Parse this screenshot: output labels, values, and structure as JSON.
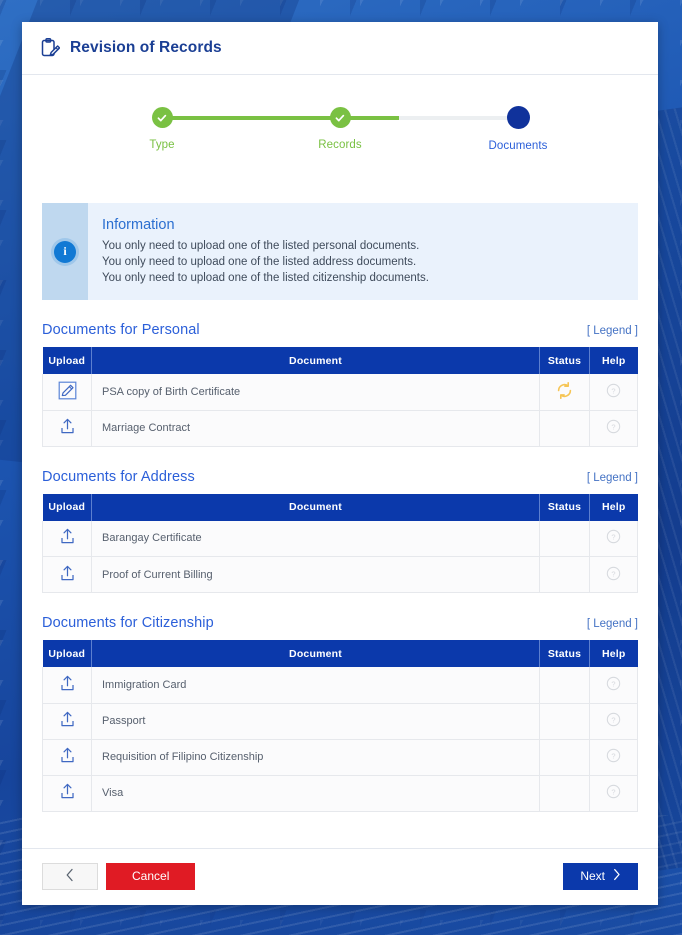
{
  "header": {
    "title": "Revision of Records",
    "icon": "clipboard-edit-icon"
  },
  "stepper": {
    "steps": [
      {
        "label": "Type",
        "state": "done",
        "icon": "check-icon"
      },
      {
        "label": "Records",
        "state": "done",
        "icon": "check-icon"
      },
      {
        "label": "Documents",
        "state": "active",
        "icon": "dot-icon"
      }
    ],
    "colors": {
      "done": "#7ac143",
      "active": "#10329b",
      "track": "#eceff1"
    }
  },
  "information": {
    "icon": "info-circle-icon",
    "title": "Information",
    "lines": [
      "You only need to upload one of the listed personal documents.",
      "You only need to upload one of the listed address documents.",
      "You only need to upload one of the listed citizenship documents."
    ]
  },
  "columns": {
    "upload": "Upload",
    "document": "Document",
    "status": "Status",
    "help": "Help"
  },
  "legend_label": "[ Legend ]",
  "sections": [
    {
      "title": "Documents for Personal",
      "rows": [
        {
          "document": "PSA copy of Birth Certificate",
          "upload_icon": "edit-pencil-icon",
          "status_icon": "sync-pending-icon",
          "help_icon": "help-circle-icon"
        },
        {
          "document": "Marriage Contract",
          "upload_icon": "upload-icon",
          "status_icon": "",
          "help_icon": "help-circle-icon"
        }
      ]
    },
    {
      "title": "Documents for Address",
      "rows": [
        {
          "document": "Barangay Certificate",
          "upload_icon": "upload-icon",
          "status_icon": "",
          "help_icon": "help-circle-icon"
        },
        {
          "document": "Proof of Current Billing",
          "upload_icon": "upload-icon",
          "status_icon": "",
          "help_icon": "help-circle-icon"
        }
      ]
    },
    {
      "title": "Documents for Citizenship",
      "rows": [
        {
          "document": "Immigration Card",
          "upload_icon": "upload-icon",
          "status_icon": "",
          "help_icon": "help-circle-icon"
        },
        {
          "document": "Passport",
          "upload_icon": "upload-icon",
          "status_icon": "",
          "help_icon": "help-circle-icon"
        },
        {
          "document": "Requisition of Filipino Citizenship",
          "upload_icon": "upload-icon",
          "status_icon": "",
          "help_icon": "help-circle-icon"
        },
        {
          "document": "Visa",
          "upload_icon": "upload-icon",
          "status_icon": "",
          "help_icon": "help-circle-icon"
        }
      ]
    }
  ],
  "footer": {
    "back_icon": "chevron-left-icon",
    "cancel_label": "Cancel",
    "next_label": "Next",
    "next_icon": "chevron-right-icon"
  },
  "colors": {
    "brand_blue": "#0b39ab",
    "title_blue": "#1b3f94",
    "link_blue": "#4472c4",
    "green": "#7ac143",
    "red": "#e01b24",
    "orange": "#f6c555"
  }
}
